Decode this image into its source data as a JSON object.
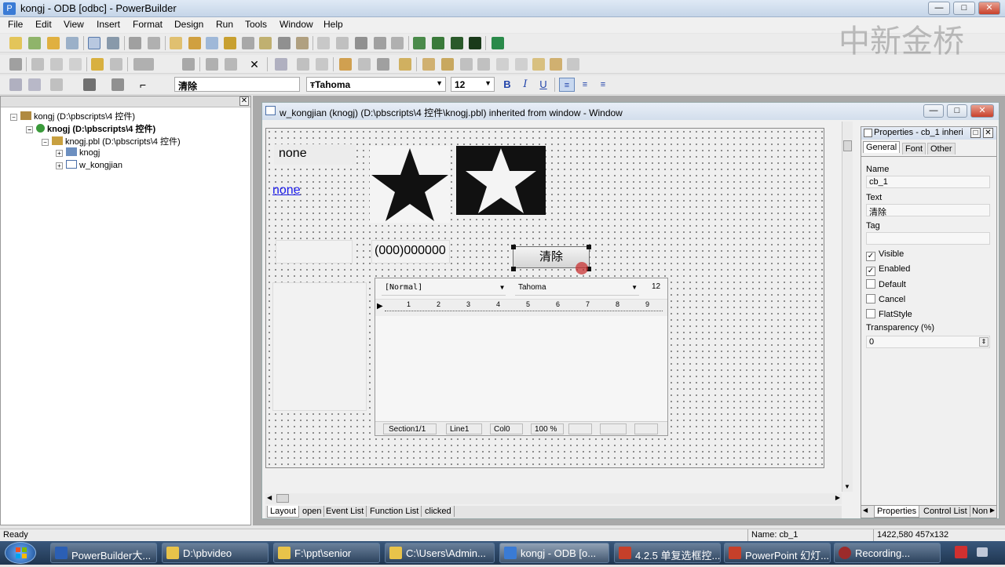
{
  "window": {
    "title": "kongj - ODB [odbc]  - PowerBuilder",
    "min": "—",
    "max": "□",
    "close": "✕"
  },
  "watermark": "中新金桥",
  "menu": [
    "File",
    "Edit",
    "View",
    "Insert",
    "Format",
    "Design",
    "Run",
    "Tools",
    "Window",
    "Help"
  ],
  "format_toolbar": {
    "text_value": "清除",
    "font_name": "Tahoma",
    "font_size": "12",
    "bold": "B",
    "italic": "I",
    "underline": "U"
  },
  "tree": [
    {
      "label": "kongj (D:\\pbscripts\\4 控件)",
      "bold": false
    },
    {
      "label": "knogj (D:\\pbscripts\\4 控件)",
      "bold": true
    },
    {
      "label": "knogj.pbl (D:\\pbscripts\\4 控件)",
      "bold": false
    },
    {
      "label": "knogj",
      "bold": false
    },
    {
      "label": "w_kongjian",
      "bold": false
    }
  ],
  "designer": {
    "title": "w_kongjian (knogj) (D:\\pbscripts\\4 控件\\knogj.pbl) inherited from window - Window",
    "static_text": "none",
    "link_text": "none",
    "masked_edit": "(000)000000",
    "button_label": "清除",
    "rte": {
      "style": "[Normal]",
      "font": "Tahoma",
      "size": "12",
      "ruler": [
        "1",
        "2",
        "3",
        "4",
        "5",
        "6",
        "7",
        "8",
        "9"
      ],
      "status": [
        "Section1/1",
        "Line1",
        "Col0",
        "100 %"
      ]
    },
    "tabs": [
      "Layout",
      "open",
      "Event List",
      "Function List",
      "clicked"
    ]
  },
  "properties": {
    "title": "Properties - cb_1 inheri",
    "tabs": [
      "General",
      "Font",
      "Other"
    ],
    "name_label": "Name",
    "name_value": "cb_1",
    "text_label": "Text",
    "text_value": "清除",
    "tag_label": "Tag",
    "tag_value": "",
    "checks": [
      {
        "label": "Visible",
        "checked": true
      },
      {
        "label": "Enabled",
        "checked": true
      },
      {
        "label": "Default",
        "checked": false
      },
      {
        "label": "Cancel",
        "checked": false
      },
      {
        "label": "FlatStyle",
        "checked": false
      }
    ],
    "transparency_label": "Transparency (%)",
    "transparency_value": "0",
    "bottom_tabs": [
      "Properties",
      "Control List",
      "Non"
    ]
  },
  "status": {
    "left": "Ready",
    "name": "Name: cb_1",
    "coords": "1422,580 457x132"
  },
  "taskbar": [
    {
      "label": "PowerBuilder大...",
      "color": "#2b5fb4"
    },
    {
      "label": "D:\\pbvideo",
      "color": "#e8c34a"
    },
    {
      "label": "F:\\ppt\\senior",
      "color": "#e8c34a"
    },
    {
      "label": "C:\\Users\\Admin...",
      "color": "#e8c34a"
    },
    {
      "label": "kongj - ODB [o...",
      "color": "#3a7bd5"
    },
    {
      "label": "4.2.5 单复选框控...",
      "color": "#c6402a"
    },
    {
      "label": "PowerPoint 幻灯...",
      "color": "#c6402a"
    },
    {
      "label": "Recording...",
      "color": "#9b2b2b"
    }
  ],
  "colors": {
    "accent": "#3a7bd5",
    "link": "#1a1aee",
    "star_bg": "#111111"
  }
}
